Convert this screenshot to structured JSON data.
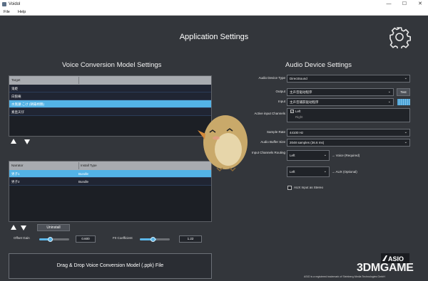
{
  "window": {
    "title": "Voidol",
    "minimize": "—",
    "maximize": "☐",
    "close": "✕"
  },
  "menu": [
    "File",
    "Help"
  ],
  "page_title": "Application Settings",
  "model_section": {
    "title": "Voice Conversion Model Settings",
    "table1": {
      "header": "Target",
      "rows": [
        "鬼姫",
        "白狼庵",
        "水無瀬 こけ (朝霧梢鶴)",
        "素直天仔"
      ],
      "selected_index": 2
    },
    "table2": {
      "headers": [
        "Narrator",
        "Install Type"
      ],
      "rows": [
        {
          "name": "男子1",
          "type": "Bundle"
        },
        {
          "name": "男子2",
          "type": "Bundle"
        }
      ],
      "selected_index": 0
    },
    "uninstall_label": "Uninstall",
    "offset_gain": {
      "label": "Offset Gain",
      "value": "0.600",
      "level": 0.42
    },
    "f0_coefficient": {
      "label": "F0 Coefficient",
      "value": "1.22",
      "level": 0.55
    },
    "drop_zone": "Drag & Drop Voice Conversion Model (.ppk) File"
  },
  "audio_section": {
    "title": "Audio Device Settings",
    "device_type": {
      "label": "Audio Device Type",
      "value": "DirectSound"
    },
    "output": {
      "label": "Output",
      "value": "主声音驱动程序",
      "test_label": "Test"
    },
    "input": {
      "label": "Input",
      "value": "主声音捕获驱动程序"
    },
    "active_input": {
      "label": "Active input Channels",
      "channels": [
        "Left",
        "Right"
      ],
      "checked": [
        true,
        false
      ]
    },
    "sample_rate": {
      "label": "Sample Rate",
      "value": "44100 Hz"
    },
    "buffer_size": {
      "label": "Audio Buffer Size",
      "value": "2048 samples (36.6 ms)"
    },
    "routing": {
      "label": "Input Channels Routing",
      "rows": [
        {
          "value": "Left",
          "target": "→ Voice (Required)"
        },
        {
          "value": "Left",
          "target": "→ AUX (Optional)"
        }
      ]
    },
    "aux_stereo": {
      "label": "AUX Input as Stereo",
      "checked": false
    }
  },
  "asio": {
    "logo": "ASIO",
    "note": "ASIO is a registered trademark of Steinberg Media Technologies GmbH"
  },
  "watermark": "3DMGAME",
  "colors": {
    "background": "#33363b",
    "accent": "#53b3e6",
    "panel": "#1c1f25"
  }
}
